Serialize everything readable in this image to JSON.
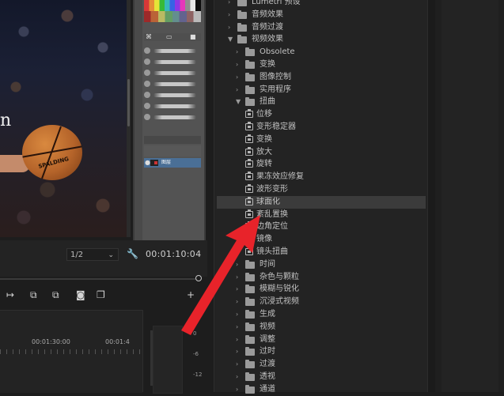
{
  "preview": {
    "title_fragment": "n",
    "ball_brand": "SPALDING"
  },
  "brush_panel": {
    "layer_name": "图层"
  },
  "monitor": {
    "zoom_value": "1/2",
    "timecode": "00:01:10:04"
  },
  "timeline": {
    "ruler_labels": [
      "00:01:30:00",
      "00:01:4"
    ],
    "meter_labels": [
      "0",
      "-6",
      "-12"
    ]
  },
  "effects_tree": [
    {
      "label": "Lumetri 预设",
      "type": "folder",
      "level": 0,
      "expanded": false
    },
    {
      "label": "音频效果",
      "type": "folder",
      "level": 0,
      "expanded": false
    },
    {
      "label": "音频过渡",
      "type": "folder",
      "level": 0,
      "expanded": false
    },
    {
      "label": "视频效果",
      "type": "folder",
      "level": 0,
      "expanded": true
    },
    {
      "label": "Obsolete",
      "type": "folder",
      "level": 1,
      "expanded": false
    },
    {
      "label": "变换",
      "type": "folder",
      "level": 1,
      "expanded": false
    },
    {
      "label": "图像控制",
      "type": "folder",
      "level": 1,
      "expanded": false
    },
    {
      "label": "实用程序",
      "type": "folder",
      "level": 1,
      "expanded": false
    },
    {
      "label": "扭曲",
      "type": "folder",
      "level": 1,
      "expanded": true
    },
    {
      "label": "位移",
      "type": "effect",
      "level": 2
    },
    {
      "label": "变形稳定器",
      "type": "effect",
      "level": 2
    },
    {
      "label": "变换",
      "type": "effect",
      "level": 2
    },
    {
      "label": "放大",
      "type": "effect",
      "level": 2
    },
    {
      "label": "旋转",
      "type": "effect",
      "level": 2
    },
    {
      "label": "果冻效应修复",
      "type": "effect",
      "level": 2
    },
    {
      "label": "波形变形",
      "type": "effect",
      "level": 2
    },
    {
      "label": "球面化",
      "type": "effect",
      "level": 2,
      "selected": true
    },
    {
      "label": "紊乱置换",
      "type": "effect",
      "level": 2
    },
    {
      "label": "边角定位",
      "type": "effect",
      "level": 2
    },
    {
      "label": "镜像",
      "type": "effect",
      "level": 2
    },
    {
      "label": "镜头扭曲",
      "type": "effect",
      "level": 2
    },
    {
      "label": "时间",
      "type": "folder",
      "level": 1,
      "expanded": false
    },
    {
      "label": "杂色与颗粒",
      "type": "folder",
      "level": 1,
      "expanded": false
    },
    {
      "label": "模糊与锐化",
      "type": "folder",
      "level": 1,
      "expanded": false
    },
    {
      "label": "沉浸式视频",
      "type": "folder",
      "level": 1,
      "expanded": false
    },
    {
      "label": "生成",
      "type": "folder",
      "level": 1,
      "expanded": false
    },
    {
      "label": "视频",
      "type": "folder",
      "level": 1,
      "expanded": false
    },
    {
      "label": "调整",
      "type": "folder",
      "level": 1,
      "expanded": false
    },
    {
      "label": "过时",
      "type": "folder",
      "level": 1,
      "expanded": false
    },
    {
      "label": "过渡",
      "type": "folder",
      "level": 1,
      "expanded": false
    },
    {
      "label": "透视",
      "type": "folder",
      "level": 1,
      "expanded": false
    },
    {
      "label": "通道",
      "type": "folder",
      "level": 1,
      "expanded": false
    }
  ],
  "colors": {
    "annotation_arrow": "#e8232a",
    "selected_row": "#3b3b3b",
    "panel_bg": "#232323"
  }
}
